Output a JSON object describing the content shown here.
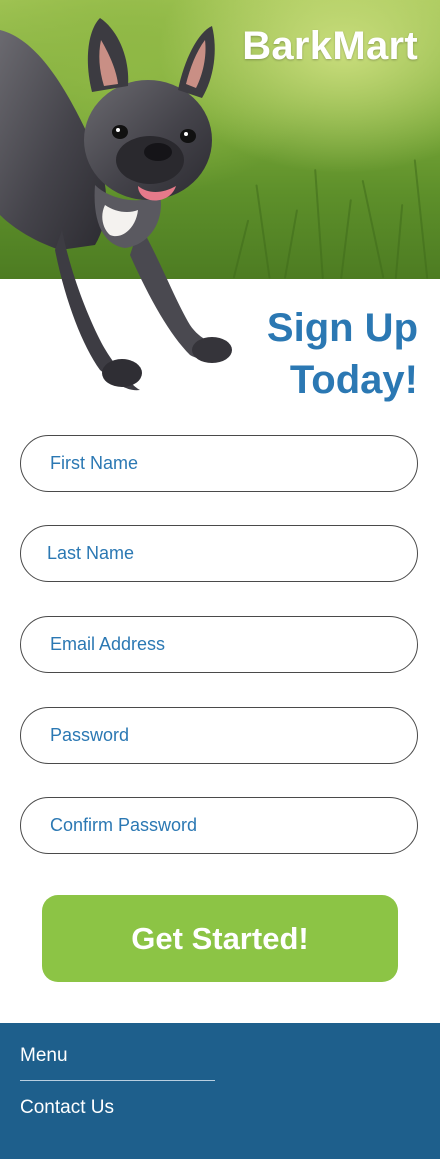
{
  "header": {
    "brand": "BarkMart"
  },
  "hero": {
    "image": "french-bulldog-running-on-grass"
  },
  "signup": {
    "title_line1": "Sign Up",
    "title_line2": "Today!"
  },
  "form": {
    "first_name_placeholder": "First Name",
    "last_name_placeholder": "Last Name",
    "email_placeholder": "Email Address",
    "password_placeholder": "Password",
    "confirm_password_placeholder": "Confirm Password",
    "submit_label": "Get Started!"
  },
  "footer": {
    "menu_label": "Menu",
    "contact_label": "Contact Us"
  },
  "colors": {
    "accent_blue": "#2b78b3",
    "button_green": "#8cc445",
    "footer_blue": "#1e5f8c"
  }
}
